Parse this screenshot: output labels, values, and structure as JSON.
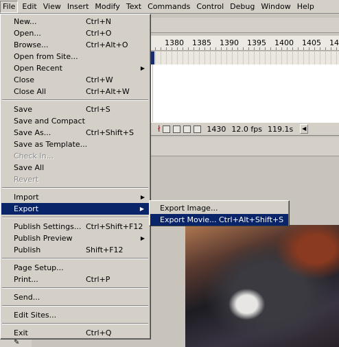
{
  "menubar": [
    "File",
    "Edit",
    "View",
    "Insert",
    "Modify",
    "Text",
    "Commands",
    "Control",
    "Debug",
    "Window",
    "Help"
  ],
  "timeline": {
    "ruler": [
      "1380",
      "1385",
      "1390",
      "1395",
      "1400",
      "1405",
      "14"
    ],
    "frame": "1430",
    "fps": "12.0 fps",
    "time": "119.1s"
  },
  "file_menu": {
    "new": {
      "label": "New...",
      "shortcut": "Ctrl+N"
    },
    "open": {
      "label": "Open...",
      "shortcut": "Ctrl+O"
    },
    "browse": {
      "label": "Browse...",
      "shortcut": "Ctrl+Alt+O"
    },
    "open_from_site": {
      "label": "Open from Site..."
    },
    "open_recent": {
      "label": "Open Recent"
    },
    "close": {
      "label": "Close",
      "shortcut": "Ctrl+W"
    },
    "close_all": {
      "label": "Close All",
      "shortcut": "Ctrl+Alt+W"
    },
    "save": {
      "label": "Save",
      "shortcut": "Ctrl+S"
    },
    "save_and_compact": {
      "label": "Save and Compact"
    },
    "save_as": {
      "label": "Save As...",
      "shortcut": "Ctrl+Shift+S"
    },
    "save_as_template": {
      "label": "Save as Template..."
    },
    "check_in": {
      "label": "Check In..."
    },
    "save_all": {
      "label": "Save All"
    },
    "revert": {
      "label": "Revert"
    },
    "import": {
      "label": "Import"
    },
    "export": {
      "label": "Export"
    },
    "publish_settings": {
      "label": "Publish Settings...",
      "shortcut": "Ctrl+Shift+F12"
    },
    "publish_preview": {
      "label": "Publish Preview"
    },
    "publish": {
      "label": "Publish",
      "shortcut": "Shift+F12"
    },
    "page_setup": {
      "label": "Page Setup..."
    },
    "print": {
      "label": "Print...",
      "shortcut": "Ctrl+P"
    },
    "send": {
      "label": "Send..."
    },
    "edit_sites": {
      "label": "Edit Sites..."
    },
    "exit": {
      "label": "Exit",
      "shortcut": "Ctrl+Q"
    }
  },
  "export_submenu": {
    "export_image": {
      "label": "Export Image..."
    },
    "export_movie": {
      "label": "Export Movie...",
      "shortcut": "Ctrl+Alt+Shift+S"
    }
  },
  "icons": {
    "submenu_arrow": "▶",
    "scroll_left": "◀",
    "pencil": "✎"
  },
  "colors": {
    "menu_bg": "#d4d0c8",
    "highlight": "#0a246a",
    "disabled_text": "#8a8a8a"
  }
}
